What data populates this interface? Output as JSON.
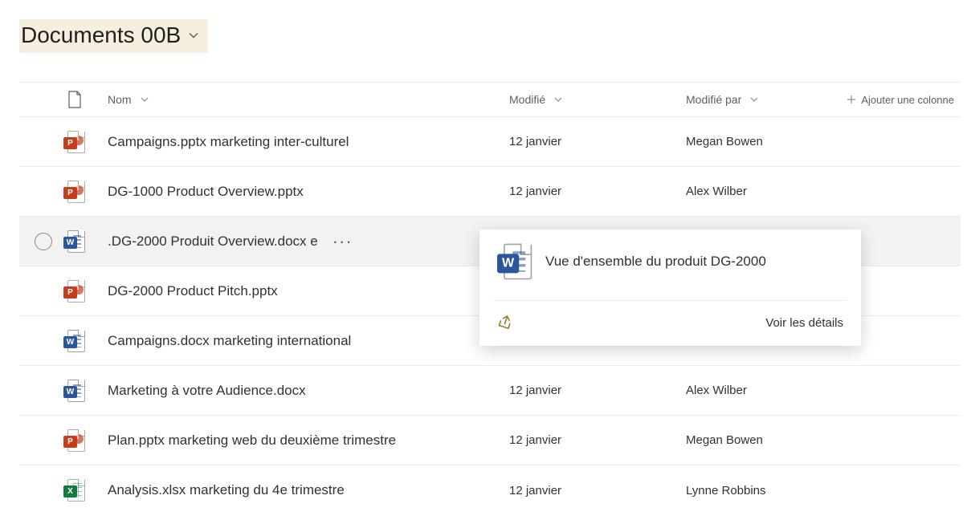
{
  "library": {
    "title": "Documents 00B"
  },
  "columns": {
    "name": "Nom",
    "modified": "Modifié",
    "modifiedBy": "Modifié par",
    "addColumn": "Ajouter une colonne"
  },
  "rows": [
    {
      "icon": "ppt",
      "name": "Campaigns.pptx marketing inter-culturel",
      "modified": "12 janvier",
      "modifiedBy": "Megan Bowen",
      "selected": false
    },
    {
      "icon": "ppt",
      "name": "DG-1000 Product Overview.pptx",
      "modified": "12 janvier",
      "modifiedBy": "Alex Wilber",
      "selected": false
    },
    {
      "icon": "word",
      "name": ".DG-2000 Produit Overview.docx e",
      "modified": "",
      "modifiedBy": "",
      "selected": true
    },
    {
      "icon": "ppt",
      "name": "DG-2000 Product Pitch.pptx",
      "modified": "",
      "modifiedBy": "",
      "selected": false
    },
    {
      "icon": "word",
      "name": "Campaigns.docx marketing international",
      "modified": "",
      "modifiedBy": "",
      "selected": false
    },
    {
      "icon": "word",
      "name": "Marketing à votre Audience.docx",
      "modified": "12 janvier",
      "modifiedBy": "Alex Wilber",
      "selected": false
    },
    {
      "icon": "ppt",
      "name": "Plan.pptx marketing web du deuxième trimestre",
      "modified": "12 janvier",
      "modifiedBy": "Megan Bowen",
      "selected": false
    },
    {
      "icon": "xls",
      "name": "Analysis.xlsx marketing du 4e trimestre",
      "modified": "12 janvier",
      "modifiedBy": "Lynne Robbins",
      "selected": false
    }
  ],
  "hoverCard": {
    "title": "Vue d'ensemble du produit DG-2000",
    "detailsLabel": "Voir les détails"
  }
}
